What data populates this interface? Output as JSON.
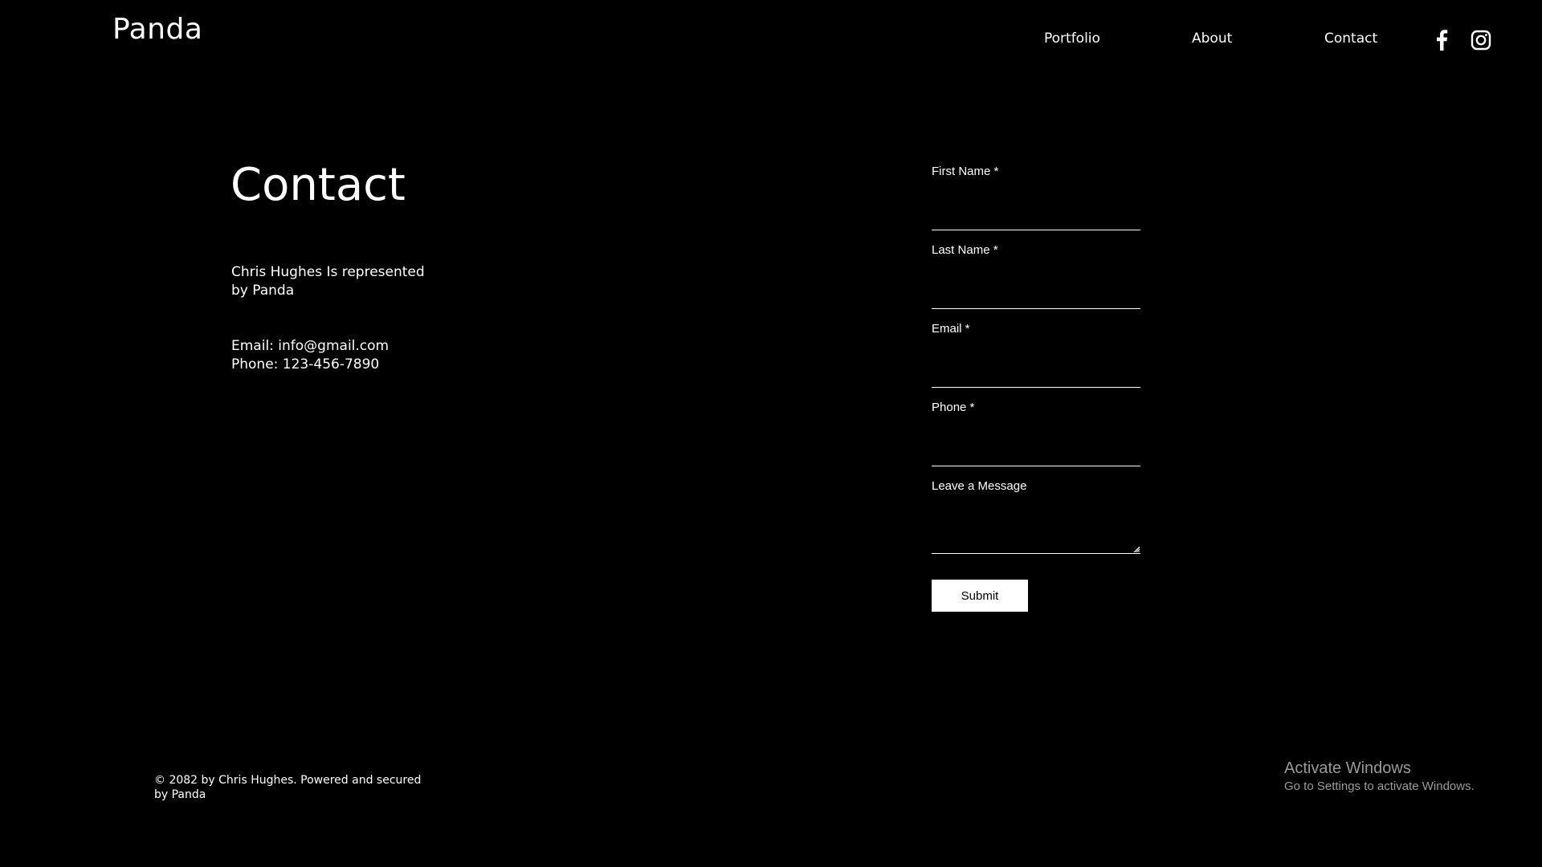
{
  "header": {
    "logo": "Panda",
    "nav": {
      "portfolio": "Portfolio",
      "about": "About",
      "contact": "Contact"
    },
    "social": [
      "facebook-icon",
      "instagram-icon"
    ]
  },
  "main": {
    "title": "Contact",
    "represented": "Chris Hughes Is represented by Panda",
    "email": "Email: info@gmail.com",
    "phone": "Phone: 123-456-7890"
  },
  "form": {
    "first_name_label": "First Name *",
    "first_name_value": "",
    "last_name_label": "Last Name *",
    "last_name_value": "",
    "email_label": "Email *",
    "email_value": "",
    "phone_label": "Phone *",
    "phone_value": "",
    "message_label": "Leave a Message",
    "message_value": "",
    "submit_label": "Submit"
  },
  "footer": {
    "copyright": "© 2082 by Chris Hughes. Powered and secured by Panda"
  },
  "watermark": {
    "title": "Activate Windows",
    "subtitle": "Go to Settings to activate Windows."
  },
  "colors": {
    "background": "#000000",
    "text": "#ffffff",
    "watermark": "#9a9a9a"
  }
}
